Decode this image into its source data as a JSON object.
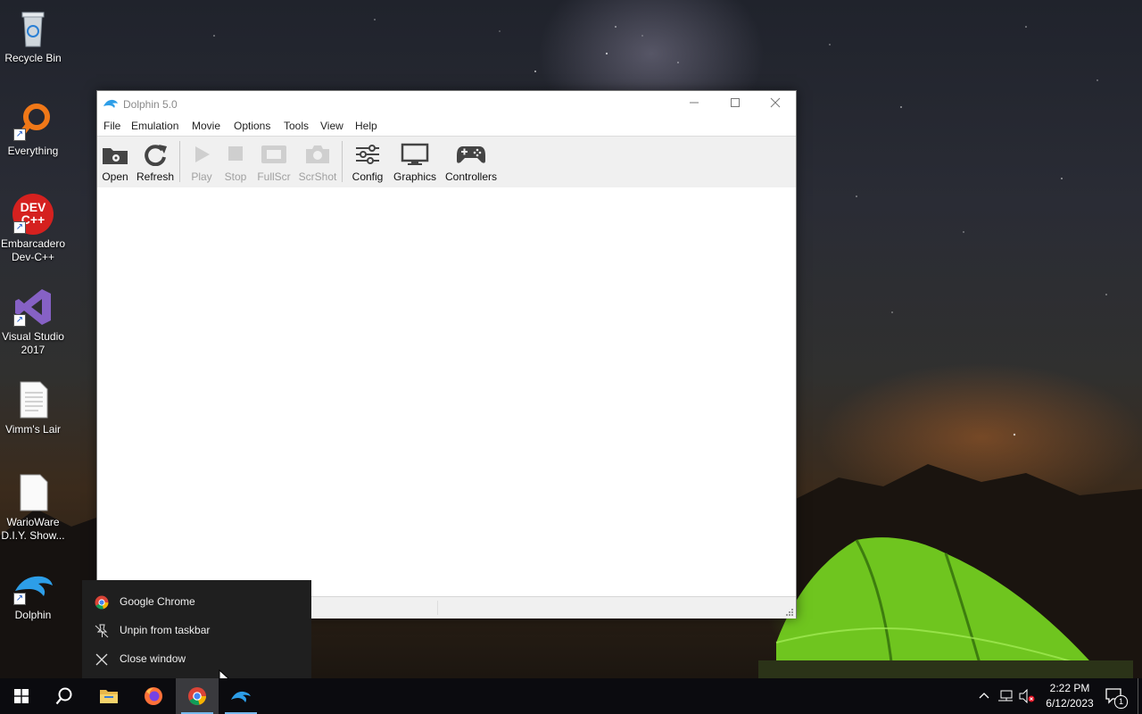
{
  "desktop": {
    "icons": [
      {
        "label": "Recycle Bin"
      },
      {
        "label": "Everything"
      },
      {
        "label": "Embarcadero Dev-C++"
      },
      {
        "label": "Visual Studio 2017"
      },
      {
        "label": "Vimm's Lair"
      },
      {
        "label": "WarioWare D.I.Y. Show..."
      },
      {
        "label": "Dolphin"
      }
    ],
    "devcpp_icon_text": [
      "DEV",
      "C++"
    ]
  },
  "window": {
    "title": "Dolphin 5.0",
    "menu": [
      "File",
      "Emulation",
      "Movie",
      "Options",
      "Tools",
      "View",
      "Help"
    ],
    "toolbar": [
      {
        "label": "Open",
        "icon": "folder-open-icon",
        "enabled": true
      },
      {
        "label": "Refresh",
        "icon": "refresh-icon",
        "enabled": true
      },
      {
        "label": "Play",
        "icon": "play-icon",
        "enabled": false
      },
      {
        "label": "Stop",
        "icon": "stop-icon",
        "enabled": false
      },
      {
        "label": "FullScr",
        "icon": "fullscreen-icon",
        "enabled": false
      },
      {
        "label": "ScrShot",
        "icon": "screenshot-icon",
        "enabled": false
      },
      {
        "label": "Config",
        "icon": "sliders-icon",
        "enabled": true
      },
      {
        "label": "Graphics",
        "icon": "monitor-icon",
        "enabled": true
      },
      {
        "label": "Controllers",
        "icon": "gamepad-icon",
        "enabled": true
      }
    ]
  },
  "jumplist": {
    "items": [
      {
        "label": "Google Chrome",
        "icon": "chrome-icon"
      },
      {
        "label": "Unpin from taskbar",
        "icon": "unpin-icon"
      },
      {
        "label": "Close window",
        "icon": "close-icon"
      }
    ]
  },
  "taskbar": {
    "items": [
      "start-icon",
      "search-icon",
      "file-explorer-icon",
      "firefox-icon",
      "chrome-icon",
      "dolphin-icon"
    ],
    "clock": {
      "time": "2:22 PM",
      "date": "6/12/2023"
    },
    "notification_count": "1"
  },
  "colors": {
    "accent": "#76b9ed",
    "taskbar": "#0b0b0f",
    "jumplist": "#1f1f1f"
  }
}
